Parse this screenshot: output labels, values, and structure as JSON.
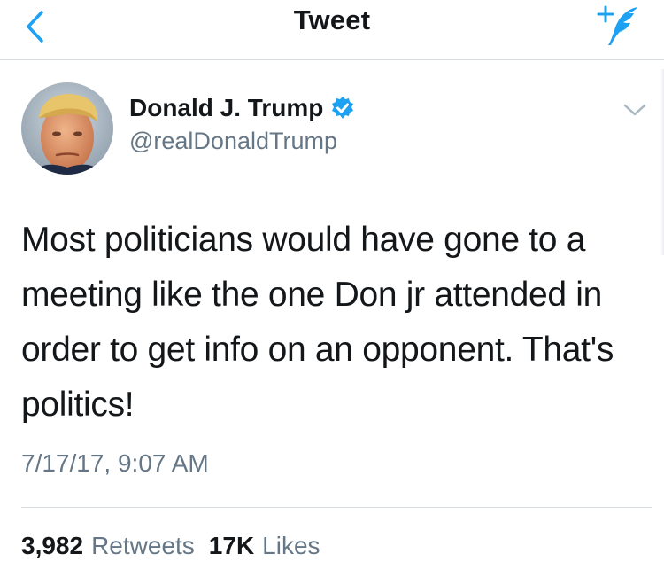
{
  "navbar": {
    "title": "Tweet",
    "back_icon": "chevron-left-icon",
    "compose_icon": "compose-tweet-icon"
  },
  "tweet": {
    "author": {
      "name": "Donald J. Trump",
      "handle": "@realDonaldTrump",
      "verified": true
    },
    "text": "Most politicians would have gone to a meeting like the one Don jr attended in order to get info on an opponent. That's politics!",
    "timestamp": "7/17/17, 9:07 AM",
    "stats": {
      "retweets_count": "3,982",
      "retweets_label": "Retweets",
      "likes_count": "17K",
      "likes_label": "Likes"
    }
  },
  "colors": {
    "accent": "#1da1f2",
    "text_primary": "#14171a",
    "text_secondary": "#657786",
    "divider": "#d8dde2"
  }
}
